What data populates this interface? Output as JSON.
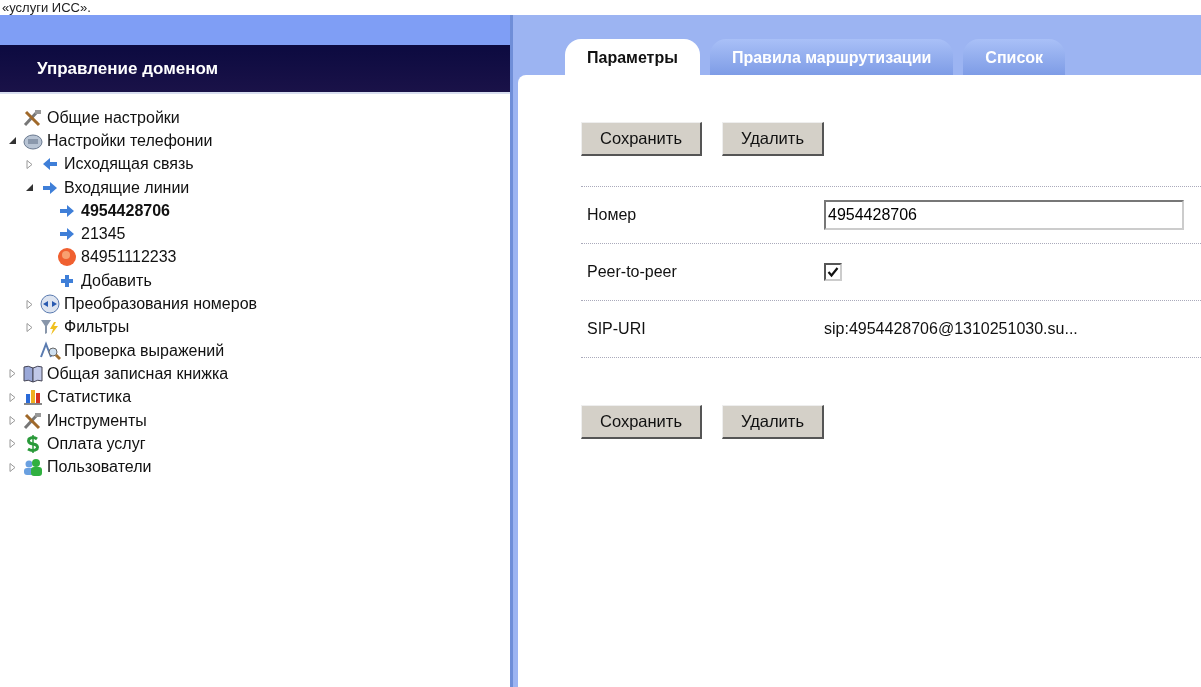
{
  "caption_fragment": "«услуги ИСС».",
  "sidebar": {
    "title": "Управление доменом",
    "tree": [
      {
        "label": "Общие настройки",
        "kind": "tools",
        "selected": false
      },
      {
        "label": "Настройки телефонии",
        "kind": "phone",
        "selected": false,
        "expanded": true,
        "children": [
          {
            "label": "Исходящая связь",
            "kind": "arrow-left",
            "selected": false,
            "expanded": false
          },
          {
            "label": "Входящие линии",
            "kind": "arrow-right",
            "selected": false,
            "expanded": true,
            "children": [
              {
                "label": "4954428706",
                "kind": "arrow-right",
                "selected": true
              },
              {
                "label": "21345",
                "kind": "arrow-right",
                "selected": false
              },
              {
                "label": "84951112233",
                "kind": "burst",
                "selected": false
              },
              {
                "label": "Добавить",
                "kind": "plus",
                "selected": false
              }
            ]
          },
          {
            "label": "Преобразования номеров",
            "kind": "exchange",
            "selected": false,
            "expanded": false
          },
          {
            "label": "Фильтры",
            "kind": "filter",
            "selected": false,
            "expanded": false
          },
          {
            "label": "Проверка выражений",
            "kind": "magnifier",
            "selected": false
          }
        ]
      },
      {
        "label": "Общая записная книжка",
        "kind": "book",
        "selected": false,
        "expanded": false
      },
      {
        "label": "Статистика",
        "kind": "chart",
        "selected": false,
        "expanded": false
      },
      {
        "label": "Инструменты",
        "kind": "tools",
        "selected": false,
        "expanded": false
      },
      {
        "label": "Оплата услуг",
        "kind": "dollar",
        "selected": false,
        "expanded": false
      },
      {
        "label": "Пользователи",
        "kind": "users",
        "selected": false,
        "expanded": false
      }
    ]
  },
  "tabs": [
    {
      "label": "Параметры",
      "selected": true
    },
    {
      "label": "Правила маршрутизации",
      "selected": false
    },
    {
      "label": "Список",
      "selected": false
    }
  ],
  "buttons_top": [
    "Сохранить",
    "Удалить"
  ],
  "form": [
    {
      "kind": "input",
      "label": "Номер",
      "value": "4954428706"
    },
    {
      "kind": "checkbox",
      "label": "Peer-to-peer",
      "checked": true
    },
    {
      "kind": "text",
      "label": "SIP-URI",
      "value": "sip:4954428706@1310251030.su..."
    }
  ],
  "buttons_bottom": [
    "Сохранить",
    "Удалить"
  ]
}
